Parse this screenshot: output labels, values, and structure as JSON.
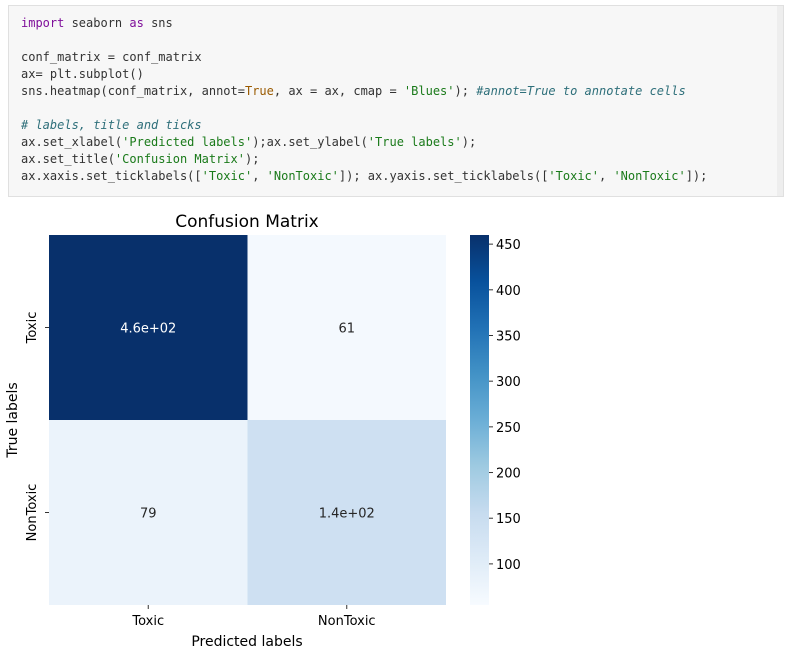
{
  "code_cell": {
    "lines": [
      [
        {
          "t": "import",
          "c": "kw"
        },
        {
          "t": " seaborn ",
          "c": ""
        },
        {
          "t": "as",
          "c": "kw"
        },
        {
          "t": " sns",
          "c": ""
        }
      ],
      [],
      [
        {
          "t": "conf_matrix = conf_matrix",
          "c": ""
        }
      ],
      [
        {
          "t": "ax= plt.subplot()",
          "c": ""
        }
      ],
      [
        {
          "t": "sns.heatmap(conf_matrix, annot=",
          "c": ""
        },
        {
          "t": "True",
          "c": "bool"
        },
        {
          "t": ", ax = ax, cmap = ",
          "c": ""
        },
        {
          "t": "'Blues'",
          "c": "str"
        },
        {
          "t": "); ",
          "c": ""
        },
        {
          "t": "#annot=True to annotate cells",
          "c": "cmt"
        }
      ],
      [],
      [
        {
          "t": "# labels, title and ticks",
          "c": "cmt"
        }
      ],
      [
        {
          "t": "ax.set_xlabel(",
          "c": ""
        },
        {
          "t": "'Predicted labels'",
          "c": "str"
        },
        {
          "t": ");ax.set_ylabel(",
          "c": ""
        },
        {
          "t": "'True labels'",
          "c": "str"
        },
        {
          "t": ");",
          "c": ""
        }
      ],
      [
        {
          "t": "ax.set_title(",
          "c": ""
        },
        {
          "t": "'Confusion Matrix'",
          "c": "str"
        },
        {
          "t": ");",
          "c": ""
        }
      ],
      [
        {
          "t": "ax.xaxis.set_ticklabels([",
          "c": ""
        },
        {
          "t": "'Toxic'",
          "c": "str"
        },
        {
          "t": ", ",
          "c": ""
        },
        {
          "t": "'NonToxic'",
          "c": "str"
        },
        {
          "t": "]); ax.yaxis.set_ticklabels([",
          "c": ""
        },
        {
          "t": "'Toxic'",
          "c": "str"
        },
        {
          "t": ", ",
          "c": ""
        },
        {
          "t": "'NonToxic'",
          "c": "str"
        },
        {
          "t": "]);",
          "c": ""
        }
      ]
    ]
  },
  "chart_data": {
    "type": "heatmap",
    "title": "Confusion Matrix",
    "xlabel": "Predicted labels",
    "ylabel": "True labels",
    "x_categories": [
      "Toxic",
      "NonToxic"
    ],
    "y_categories": [
      "Toxic",
      "NonToxic"
    ],
    "values": [
      [
        460,
        61
      ],
      [
        79,
        140
      ]
    ],
    "annotations": [
      [
        "4.6e+02",
        "61"
      ],
      [
        "79",
        "1.4e+02"
      ]
    ],
    "colormap": "Blues",
    "colorbar": {
      "min": 55,
      "max": 460,
      "ticks": [
        100,
        150,
        200,
        250,
        300,
        350,
        400,
        450
      ],
      "tick_labels": [
        "100",
        "150",
        "200",
        "250",
        "300",
        "350",
        "400",
        "450"
      ]
    },
    "colors": {
      "max": "#08306b",
      "min": "#f7fbff"
    }
  }
}
